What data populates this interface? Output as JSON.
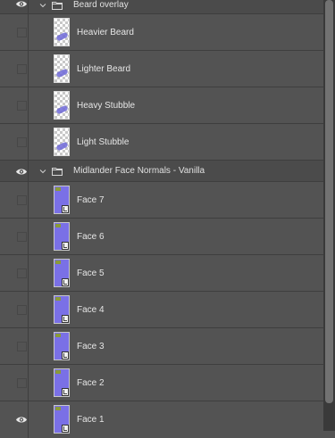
{
  "layers_panel": {
    "groups": [
      {
        "label": "Beard overlay",
        "visible": true,
        "expanded": true,
        "layers": [
          {
            "label": "Heavier Beard",
            "visible": false,
            "thumbnail": "transparent-checker"
          },
          {
            "label": "Lighter Beard",
            "visible": false,
            "thumbnail": "transparent-checker"
          },
          {
            "label": "Heavy Stubble",
            "visible": false,
            "thumbnail": "transparent-checker"
          },
          {
            "label": "Light Stubble",
            "visible": false,
            "thumbnail": "transparent-checker"
          }
        ]
      },
      {
        "label": "Midlander Face Normals - Vanilla",
        "visible": true,
        "expanded": true,
        "layers": [
          {
            "label": "Face 7",
            "visible": false,
            "thumbnail": "normal-map-smart-object"
          },
          {
            "label": "Face 6",
            "visible": false,
            "thumbnail": "normal-map-smart-object"
          },
          {
            "label": "Face 5",
            "visible": false,
            "thumbnail": "normal-map-smart-object"
          },
          {
            "label": "Face 4",
            "visible": false,
            "thumbnail": "normal-map-smart-object"
          },
          {
            "label": "Face 3",
            "visible": false,
            "thumbnail": "normal-map-smart-object"
          },
          {
            "label": "Face 2",
            "visible": false,
            "thumbnail": "normal-map-smart-object"
          },
          {
            "label": "Face 1",
            "visible": true,
            "thumbnail": "normal-map-smart-object"
          }
        ]
      }
    ]
  },
  "colors": {
    "panel_bg": "#535353",
    "group_bg": "#4b4b4b",
    "normal_map": "#7a70e6",
    "text": "#e6e6e6"
  }
}
